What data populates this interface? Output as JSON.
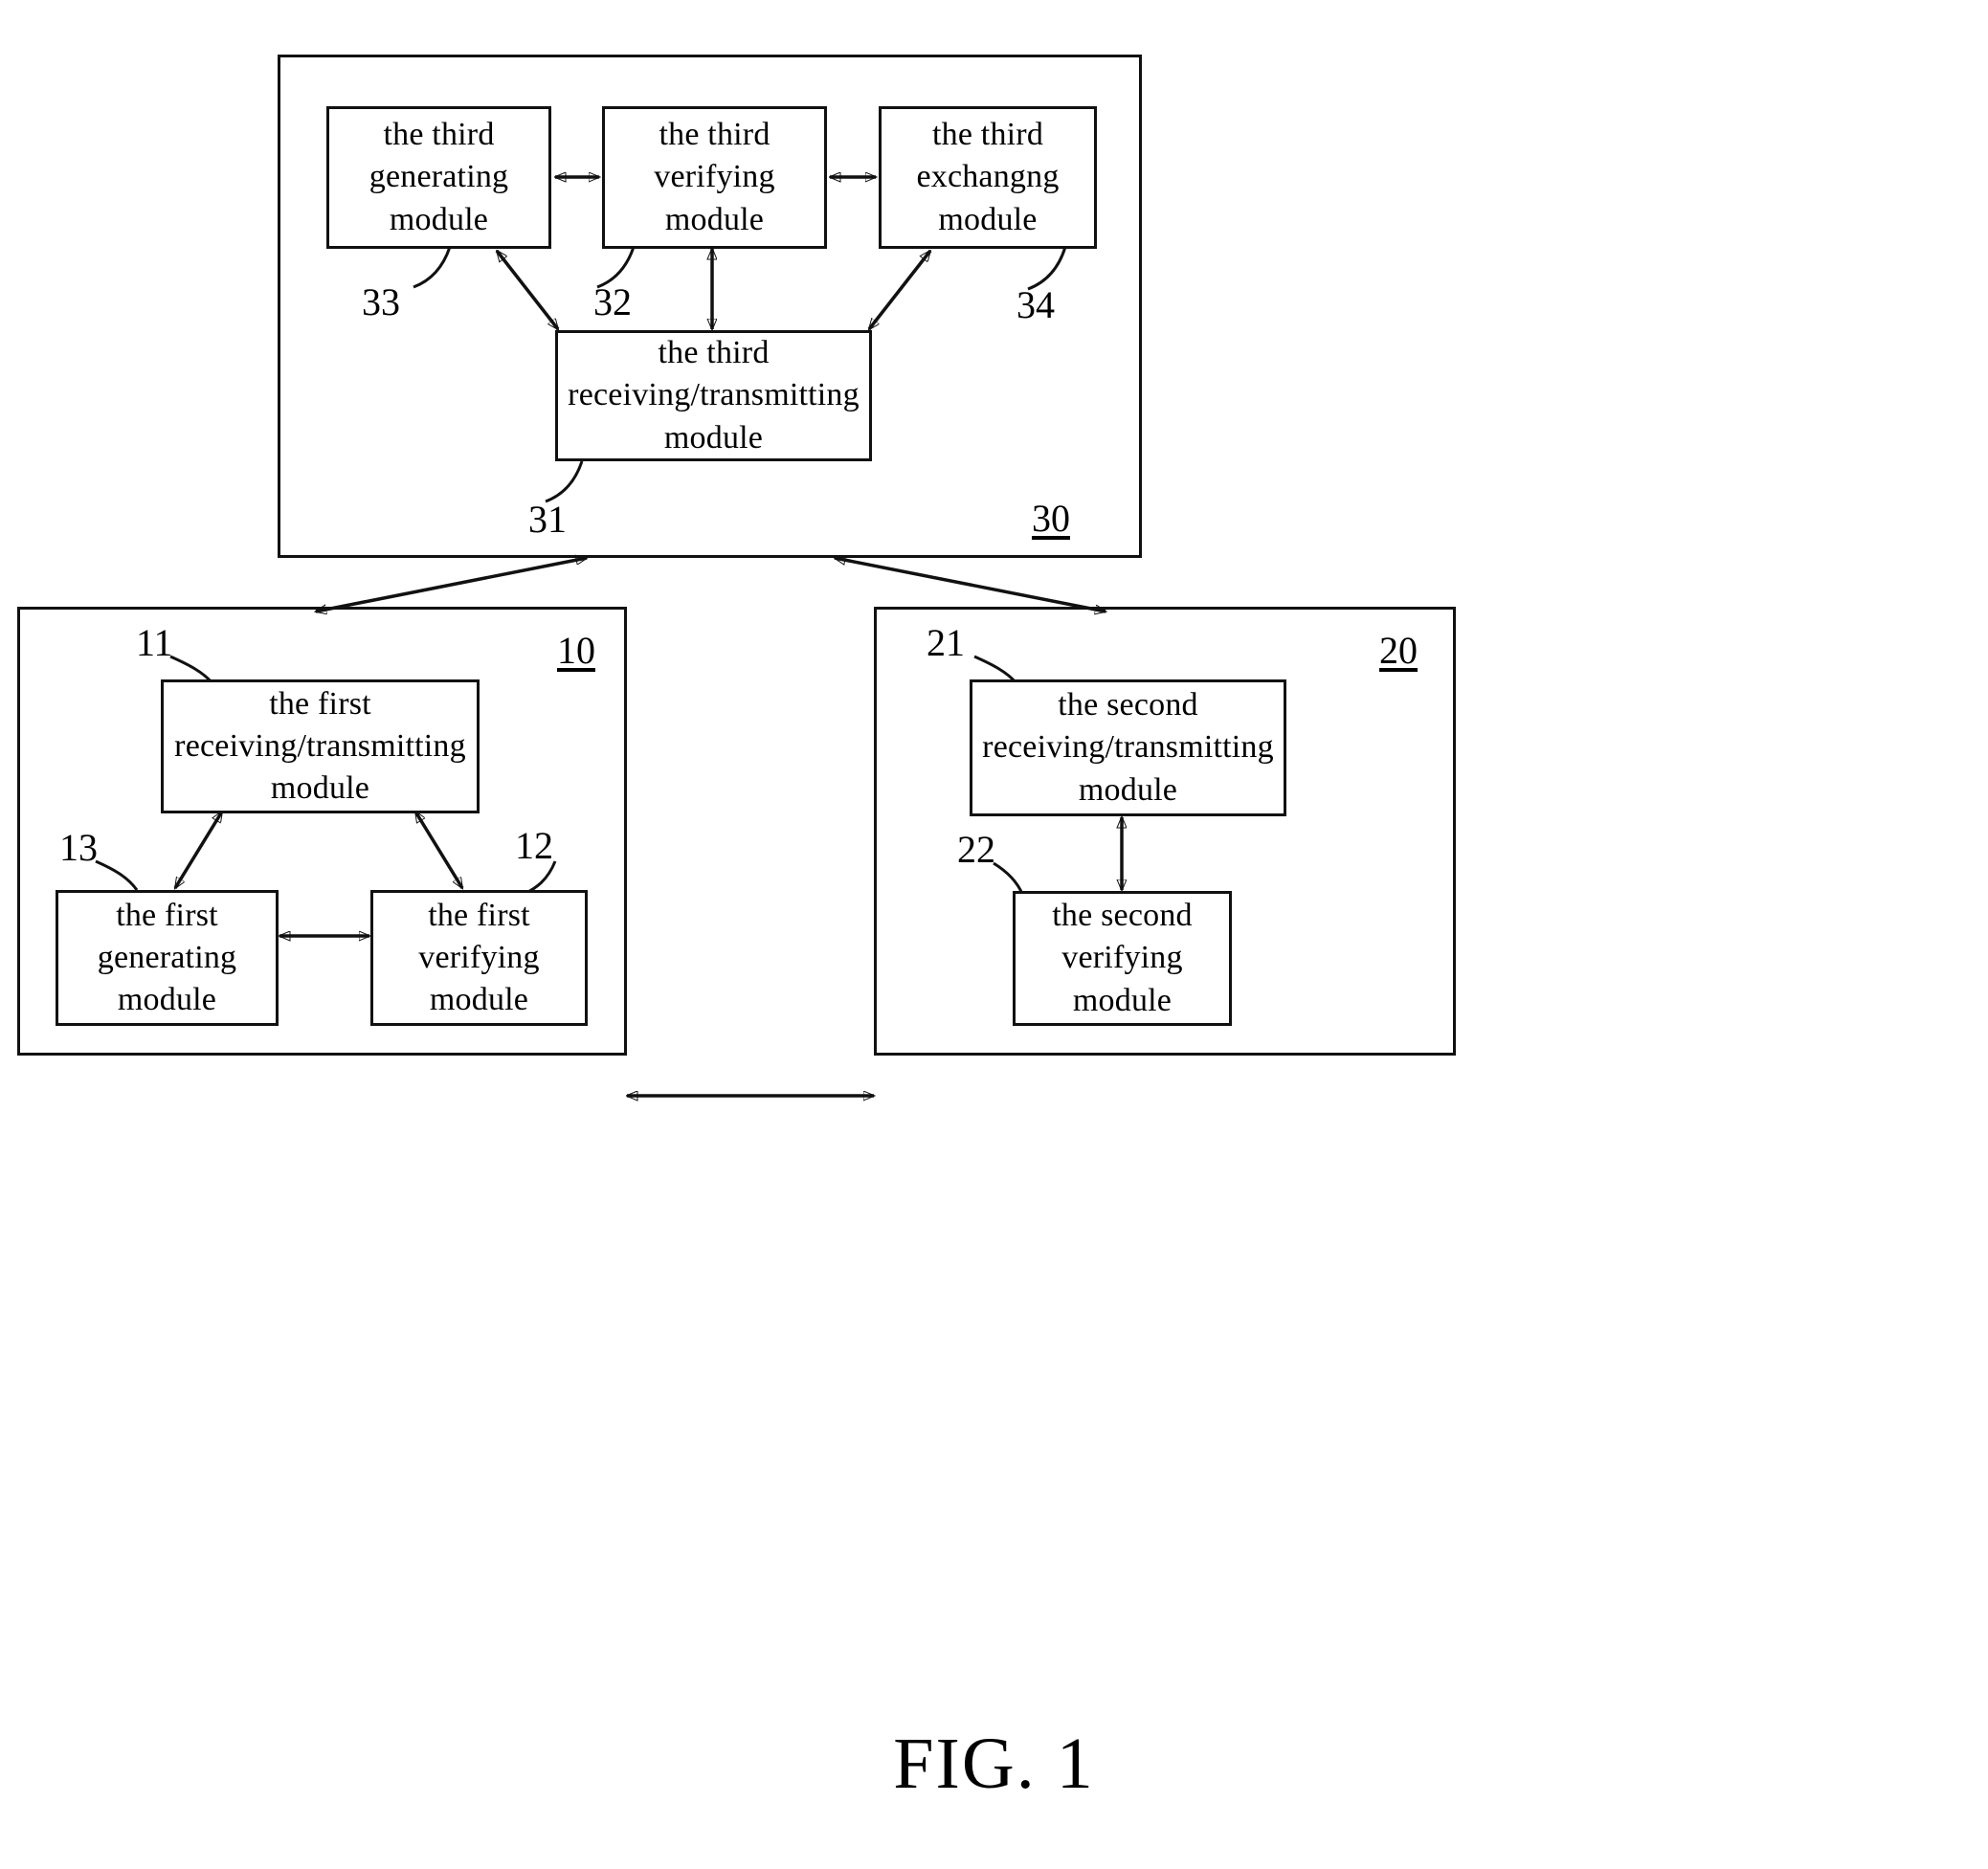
{
  "figure": {
    "caption": "FIG. 1"
  },
  "groups": [
    {
      "id": "third-device",
      "ref": "30",
      "ref_underlined": true
    },
    {
      "id": "first-device",
      "ref": "10",
      "ref_underlined": true
    },
    {
      "id": "second-device",
      "ref": "20",
      "ref_underlined": true
    }
  ],
  "modules": {
    "third_generating": {
      "lines": [
        "the third",
        "generating",
        "module"
      ],
      "ref": "33"
    },
    "third_verifying": {
      "lines": [
        "the third",
        "verifying",
        "module"
      ],
      "ref": "32"
    },
    "third_exchanging": {
      "lines": [
        "the third",
        "exchangng",
        "module"
      ],
      "ref": "34"
    },
    "third_receiving_transmitting": {
      "lines": [
        "the third",
        "receiving/transmitting",
        "module"
      ],
      "ref": "31"
    },
    "first_receiving_transmitting": {
      "lines": [
        "the first",
        "receiving/transmitting",
        "module"
      ],
      "ref": "11"
    },
    "first_generating": {
      "lines": [
        "the first",
        "generating",
        "module"
      ],
      "ref": "13"
    },
    "first_verifying": {
      "lines": [
        "the first",
        "verifying",
        "module"
      ],
      "ref": "12"
    },
    "second_receiving_transmitting": {
      "lines": [
        "the second",
        "receiving/transmitting",
        "module"
      ],
      "ref": "21"
    },
    "second_verifying": {
      "lines": [
        "the second",
        "verifying",
        "module"
      ],
      "ref": "22"
    }
  },
  "colors": {
    "stroke": "#111111",
    "background": "#ffffff"
  }
}
